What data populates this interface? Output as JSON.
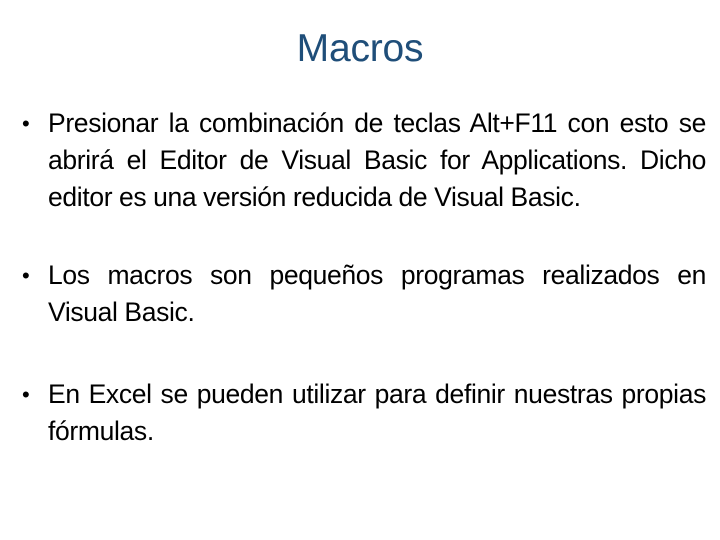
{
  "slide": {
    "title": "Macros",
    "title_color": "#1F4E79",
    "body_color": "#000000",
    "background_color": "#FFFFFF",
    "bullet_glyph": "•",
    "bullets": [
      {
        "id": "bullet-1",
        "text": "Presionar la combinación de teclas Alt+F11 con esto se abrirá el Editor de Visual Basic for Applications.  Dicho editor es una versión reducida de Visual Basic."
      },
      {
        "id": "bullet-2",
        "text": "Los macros son pequeños programas realizados en Visual Basic."
      },
      {
        "id": "bullet-3",
        "text": "En Excel se pueden utilizar para definir nuestras propias fórmulas."
      }
    ]
  }
}
